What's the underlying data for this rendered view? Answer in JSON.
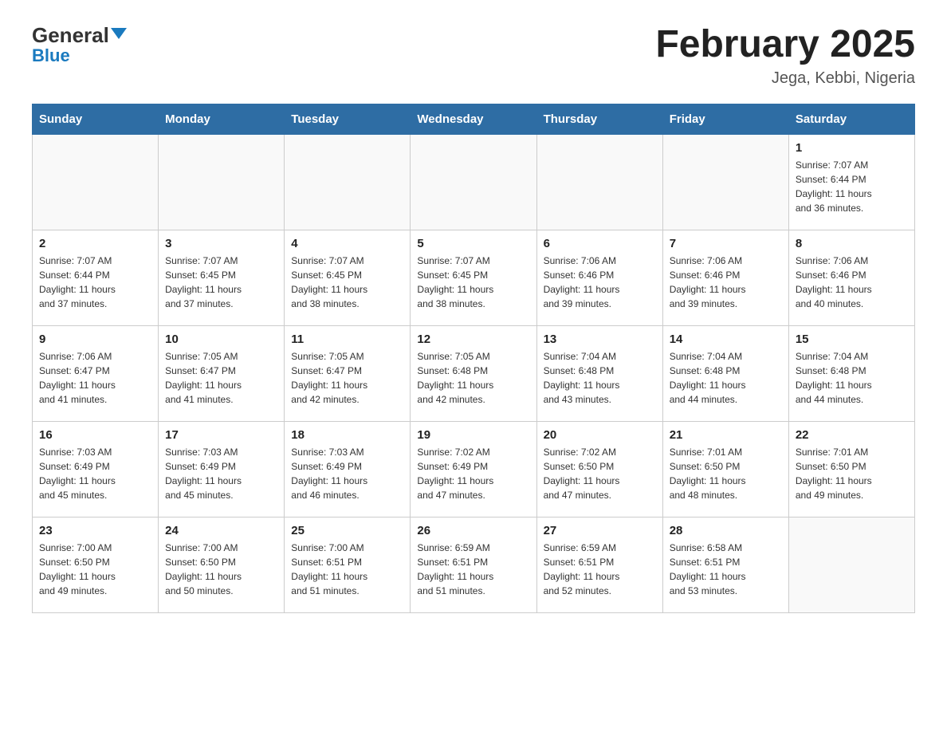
{
  "logo": {
    "top": "General",
    "bottom": "Blue"
  },
  "title": "February 2025",
  "subtitle": "Jega, Kebbi, Nigeria",
  "weekdays": [
    "Sunday",
    "Monday",
    "Tuesday",
    "Wednesday",
    "Thursday",
    "Friday",
    "Saturday"
  ],
  "weeks": [
    [
      {
        "day": "",
        "info": ""
      },
      {
        "day": "",
        "info": ""
      },
      {
        "day": "",
        "info": ""
      },
      {
        "day": "",
        "info": ""
      },
      {
        "day": "",
        "info": ""
      },
      {
        "day": "",
        "info": ""
      },
      {
        "day": "1",
        "info": "Sunrise: 7:07 AM\nSunset: 6:44 PM\nDaylight: 11 hours\nand 36 minutes."
      }
    ],
    [
      {
        "day": "2",
        "info": "Sunrise: 7:07 AM\nSunset: 6:44 PM\nDaylight: 11 hours\nand 37 minutes."
      },
      {
        "day": "3",
        "info": "Sunrise: 7:07 AM\nSunset: 6:45 PM\nDaylight: 11 hours\nand 37 minutes."
      },
      {
        "day": "4",
        "info": "Sunrise: 7:07 AM\nSunset: 6:45 PM\nDaylight: 11 hours\nand 38 minutes."
      },
      {
        "day": "5",
        "info": "Sunrise: 7:07 AM\nSunset: 6:45 PM\nDaylight: 11 hours\nand 38 minutes."
      },
      {
        "day": "6",
        "info": "Sunrise: 7:06 AM\nSunset: 6:46 PM\nDaylight: 11 hours\nand 39 minutes."
      },
      {
        "day": "7",
        "info": "Sunrise: 7:06 AM\nSunset: 6:46 PM\nDaylight: 11 hours\nand 39 minutes."
      },
      {
        "day": "8",
        "info": "Sunrise: 7:06 AM\nSunset: 6:46 PM\nDaylight: 11 hours\nand 40 minutes."
      }
    ],
    [
      {
        "day": "9",
        "info": "Sunrise: 7:06 AM\nSunset: 6:47 PM\nDaylight: 11 hours\nand 41 minutes."
      },
      {
        "day": "10",
        "info": "Sunrise: 7:05 AM\nSunset: 6:47 PM\nDaylight: 11 hours\nand 41 minutes."
      },
      {
        "day": "11",
        "info": "Sunrise: 7:05 AM\nSunset: 6:47 PM\nDaylight: 11 hours\nand 42 minutes."
      },
      {
        "day": "12",
        "info": "Sunrise: 7:05 AM\nSunset: 6:48 PM\nDaylight: 11 hours\nand 42 minutes."
      },
      {
        "day": "13",
        "info": "Sunrise: 7:04 AM\nSunset: 6:48 PM\nDaylight: 11 hours\nand 43 minutes."
      },
      {
        "day": "14",
        "info": "Sunrise: 7:04 AM\nSunset: 6:48 PM\nDaylight: 11 hours\nand 44 minutes."
      },
      {
        "day": "15",
        "info": "Sunrise: 7:04 AM\nSunset: 6:48 PM\nDaylight: 11 hours\nand 44 minutes."
      }
    ],
    [
      {
        "day": "16",
        "info": "Sunrise: 7:03 AM\nSunset: 6:49 PM\nDaylight: 11 hours\nand 45 minutes."
      },
      {
        "day": "17",
        "info": "Sunrise: 7:03 AM\nSunset: 6:49 PM\nDaylight: 11 hours\nand 45 minutes."
      },
      {
        "day": "18",
        "info": "Sunrise: 7:03 AM\nSunset: 6:49 PM\nDaylight: 11 hours\nand 46 minutes."
      },
      {
        "day": "19",
        "info": "Sunrise: 7:02 AM\nSunset: 6:49 PM\nDaylight: 11 hours\nand 47 minutes."
      },
      {
        "day": "20",
        "info": "Sunrise: 7:02 AM\nSunset: 6:50 PM\nDaylight: 11 hours\nand 47 minutes."
      },
      {
        "day": "21",
        "info": "Sunrise: 7:01 AM\nSunset: 6:50 PM\nDaylight: 11 hours\nand 48 minutes."
      },
      {
        "day": "22",
        "info": "Sunrise: 7:01 AM\nSunset: 6:50 PM\nDaylight: 11 hours\nand 49 minutes."
      }
    ],
    [
      {
        "day": "23",
        "info": "Sunrise: 7:00 AM\nSunset: 6:50 PM\nDaylight: 11 hours\nand 49 minutes."
      },
      {
        "day": "24",
        "info": "Sunrise: 7:00 AM\nSunset: 6:50 PM\nDaylight: 11 hours\nand 50 minutes."
      },
      {
        "day": "25",
        "info": "Sunrise: 7:00 AM\nSunset: 6:51 PM\nDaylight: 11 hours\nand 51 minutes."
      },
      {
        "day": "26",
        "info": "Sunrise: 6:59 AM\nSunset: 6:51 PM\nDaylight: 11 hours\nand 51 minutes."
      },
      {
        "day": "27",
        "info": "Sunrise: 6:59 AM\nSunset: 6:51 PM\nDaylight: 11 hours\nand 52 minutes."
      },
      {
        "day": "28",
        "info": "Sunrise: 6:58 AM\nSunset: 6:51 PM\nDaylight: 11 hours\nand 53 minutes."
      },
      {
        "day": "",
        "info": ""
      }
    ]
  ]
}
